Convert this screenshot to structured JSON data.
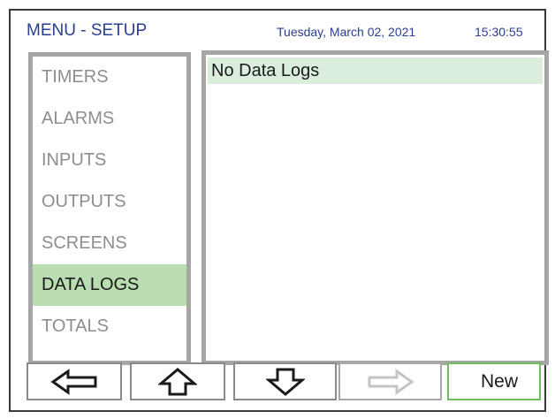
{
  "header": {
    "title": "MENU - SETUP",
    "date": "Tuesday, March 02, 2021",
    "time": "15:30:55",
    "text_color": "#2a3f94"
  },
  "sidebar": {
    "items": [
      {
        "label": "TIMERS",
        "selected": false
      },
      {
        "label": "ALARMS",
        "selected": false
      },
      {
        "label": "INPUTS",
        "selected": false
      },
      {
        "label": "OUTPUTS",
        "selected": false
      },
      {
        "label": "SCREENS",
        "selected": false
      },
      {
        "label": "DATA LOGS",
        "selected": true
      },
      {
        "label": "TOTALS",
        "selected": false
      }
    ],
    "selected_color": "#b9dcb0"
  },
  "main": {
    "rows": [
      {
        "label": "No Data Logs"
      }
    ],
    "row_color": "#dbeedd"
  },
  "toolbar": {
    "buttons": [
      {
        "icon": "arrow-left-icon",
        "enabled": true
      },
      {
        "icon": "arrow-up-icon",
        "enabled": true
      },
      {
        "icon": "arrow-down-icon",
        "enabled": true
      },
      {
        "icon": "arrow-right-icon",
        "enabled": false
      },
      {
        "label": "New",
        "enabled": true
      }
    ],
    "new_border_color": "#6fbf5c"
  }
}
